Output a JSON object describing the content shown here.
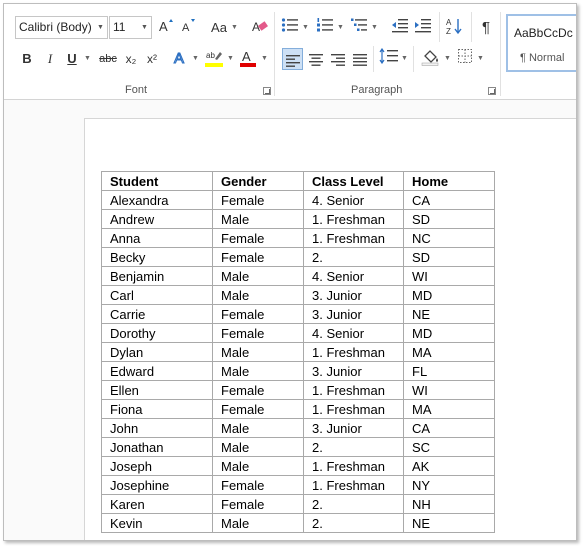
{
  "ribbon": {
    "font_name": "Calibri (Body)",
    "font_size": "11",
    "change_case_label": "Aa",
    "bold_label": "B",
    "italic_label": "I",
    "underline_label": "U",
    "strike_label": "abc",
    "subscript_label": "x₂",
    "superscript_label": "x²",
    "groups": {
      "font": "Font",
      "paragraph": "Paragraph"
    },
    "styles": {
      "preview": "AaBbCcDc",
      "normal_label": "¶ Normal"
    },
    "highlight_color": "#ffff00",
    "font_color": "#e00000",
    "active_color": "#cde0f5"
  },
  "table": {
    "headers": [
      "Student",
      "Gender",
      "Class Level",
      "Home"
    ],
    "rows": [
      [
        "Alexandra",
        "Female",
        "4. Senior",
        "CA"
      ],
      [
        "Andrew",
        "Male",
        "1. Freshman",
        "SD"
      ],
      [
        "Anna",
        "Female",
        "1. Freshman",
        "NC"
      ],
      [
        "Becky",
        "Female",
        "2.",
        "SD"
      ],
      [
        "Benjamin",
        "Male",
        "4. Senior",
        "WI"
      ],
      [
        "Carl",
        "Male",
        "3. Junior",
        "MD"
      ],
      [
        "Carrie",
        "Female",
        "3. Junior",
        "NE"
      ],
      [
        "Dorothy",
        "Female",
        "4. Senior",
        "MD"
      ],
      [
        "Dylan",
        "Male",
        "1. Freshman",
        "MA"
      ],
      [
        "Edward",
        "Male",
        "3. Junior",
        "FL"
      ],
      [
        "Ellen",
        "Female",
        "1. Freshman",
        "WI"
      ],
      [
        "Fiona",
        "Female",
        "1. Freshman",
        "MA"
      ],
      [
        "John",
        "Male",
        "3. Junior",
        "CA"
      ],
      [
        "Jonathan",
        "Male",
        "2.",
        "SC"
      ],
      [
        "Joseph",
        "Male",
        "1. Freshman",
        "AK"
      ],
      [
        "Josephine",
        "Female",
        "1. Freshman",
        "NY"
      ],
      [
        "Karen",
        "Female",
        "2.",
        "NH"
      ],
      [
        "Kevin",
        "Male",
        "2.",
        "NE"
      ]
    ]
  }
}
